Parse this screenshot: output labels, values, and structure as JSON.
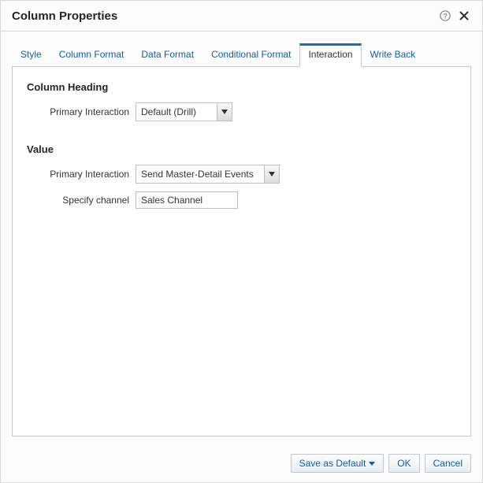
{
  "dialog": {
    "title": "Column Properties"
  },
  "tabs": {
    "style": "Style",
    "column_format": "Column Format",
    "data_format": "Data Format",
    "conditional_format": "Conditional Format",
    "interaction": "Interaction",
    "write_back": "Write Back"
  },
  "sections": {
    "column_heading": {
      "title": "Column Heading",
      "primary_interaction_label": "Primary Interaction",
      "primary_interaction_value": "Default (Drill)"
    },
    "value": {
      "title": "Value",
      "primary_interaction_label": "Primary Interaction",
      "primary_interaction_value": "Send Master-Detail Events",
      "specify_channel_label": "Specify channel",
      "specify_channel_value": "Sales Channel"
    }
  },
  "footer": {
    "save_as_default": "Save as Default",
    "ok": "OK",
    "cancel": "Cancel"
  }
}
